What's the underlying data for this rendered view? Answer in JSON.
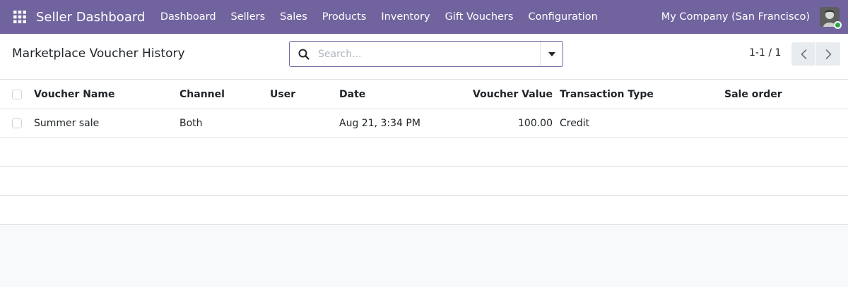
{
  "navbar": {
    "app_icon": "apps-grid-icon",
    "app_title": "Seller Dashboard",
    "menu": [
      {
        "label": "Dashboard"
      },
      {
        "label": "Sellers"
      },
      {
        "label": "Sales"
      },
      {
        "label": "Products"
      },
      {
        "label": "Inventory"
      },
      {
        "label": "Gift Vouchers"
      },
      {
        "label": "Configuration"
      }
    ],
    "company": "My Company (San Francisco)",
    "avatar_icon": "user-avatar-icon"
  },
  "control_panel": {
    "title": "Marketplace Voucher History",
    "search": {
      "placeholder": "Search...",
      "value": "",
      "icon": "search-icon",
      "toggle_icon": "caret-down-icon"
    },
    "pager": {
      "value": "1-1 / 1",
      "prev_icon": "chevron-left-icon",
      "next_icon": "chevron-right-icon"
    }
  },
  "table": {
    "columns": [
      "Voucher Name",
      "Channel",
      "User",
      "Date",
      "Voucher Value",
      "Transaction Type",
      "Sale order"
    ],
    "rows": [
      {
        "voucher_name": "Summer sale",
        "channel": "Both",
        "user": "",
        "date": "Aug 21, 3:34 PM",
        "voucher_value": "100.00",
        "transaction_type": "Credit",
        "sale_order": ""
      }
    ]
  },
  "colors": {
    "navbar_bg": "#71639e",
    "status_online": "#28a745"
  }
}
